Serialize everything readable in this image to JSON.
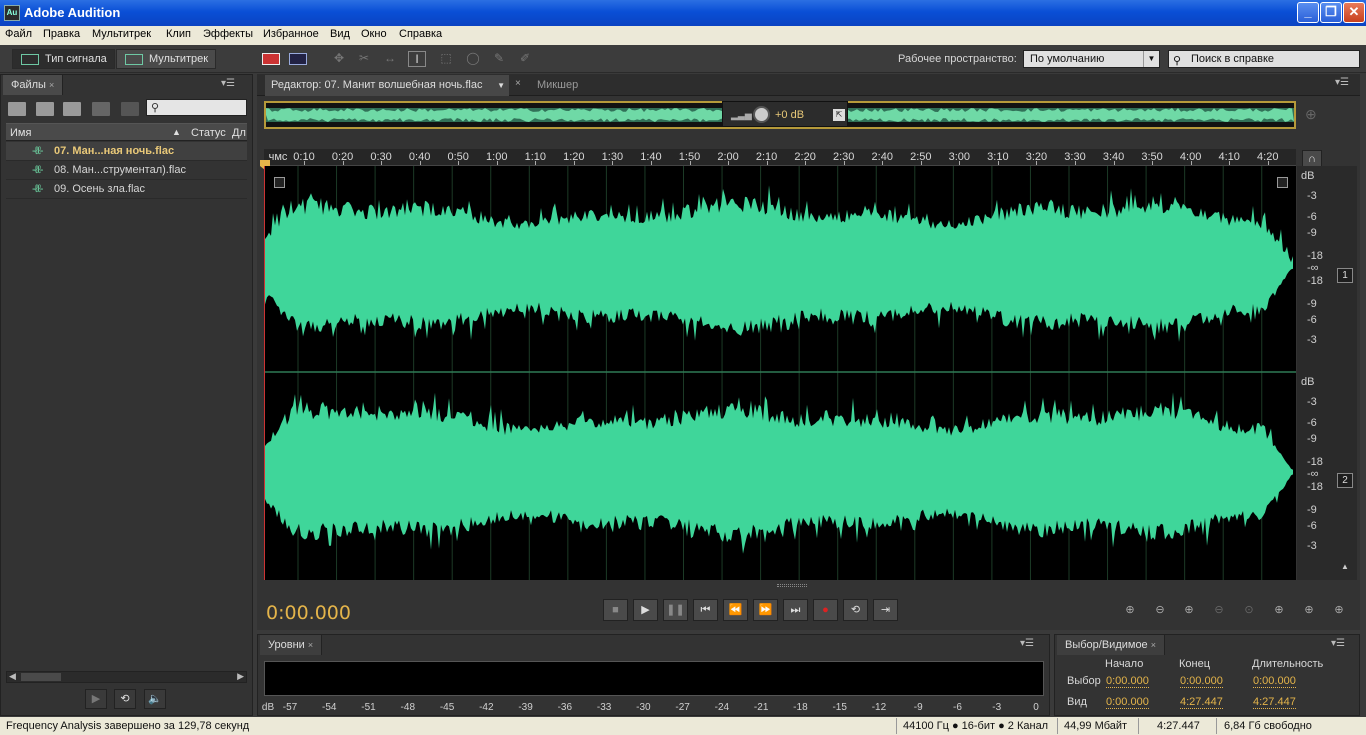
{
  "window": {
    "title": "Adobe Audition",
    "app_icon": "Au"
  },
  "menu": [
    "Файл",
    "Правка",
    "Мультитрек",
    "Клип",
    "Эффекты",
    "Избранное",
    "Вид",
    "Окно",
    "Справка"
  ],
  "toolbar": {
    "waveform_mode": "Тип сигнала",
    "multitrack_mode": "Мультитрек",
    "workspace_label": "Рабочее пространство:",
    "workspace_value": "По умолчанию",
    "help_search_placeholder": "Поиск в справке"
  },
  "files_panel": {
    "tab": "Файлы",
    "columns": [
      "Имя",
      "Статус",
      "Дл"
    ],
    "files": [
      {
        "name": "07. Ман...ная ночь.flac",
        "selected": true
      },
      {
        "name": "08. Ман...струментал).flac",
        "selected": false
      },
      {
        "name": "09. Осень зла.flac",
        "selected": false
      }
    ]
  },
  "editor": {
    "tab": "Редактор: 07. Манит волшебная ночь.flac",
    "mixer_tab": "Микшер",
    "hud_gain": "+0 dB",
    "ruler_unit": "чмс",
    "ruler_ticks": [
      "0:10",
      "0:20",
      "0:30",
      "0:40",
      "0:50",
      "1:00",
      "1:10",
      "1:20",
      "1:30",
      "1:40",
      "1:50",
      "2:00",
      "2:10",
      "2:20",
      "2:30",
      "2:40",
      "2:50",
      "3:00",
      "3:10",
      "3:20",
      "3:30",
      "3:40",
      "3:50",
      "4:00",
      "4:10",
      "4:20"
    ],
    "db_labels": [
      "dB",
      "-3",
      "-6",
      "-9",
      "-18",
      "-∞",
      "-18",
      "-9",
      "-6",
      "-3"
    ],
    "channels": [
      "1",
      "2"
    ],
    "timecode": "0:00.000",
    "wave_color": "#3fd69a"
  },
  "levels_panel": {
    "tab": "Уровни",
    "scale": [
      "dB",
      "-57",
      "-54",
      "-51",
      "-48",
      "-45",
      "-42",
      "-39",
      "-36",
      "-33",
      "-30",
      "-27",
      "-24",
      "-21",
      "-18",
      "-15",
      "-12",
      "-9",
      "-6",
      "-3",
      "0"
    ]
  },
  "selection_panel": {
    "tab": "Выбор/Видимое",
    "headers": {
      "start": "Начало",
      "end": "Конец",
      "duration": "Длительность"
    },
    "selection": {
      "label": "Выбор",
      "start": "0:00.000",
      "end": "0:00.000",
      "duration": "0:00.000"
    },
    "view": {
      "label": "Вид",
      "start": "0:00.000",
      "end": "4:27.447",
      "duration": "4:27.447"
    }
  },
  "status": {
    "message": "Frequency Analysis завершено за 129,78 секунд",
    "format": "44100 Гц ● 16-бит ● 2 Канал",
    "size": "44,99 Мбайт",
    "duration": "4:27.447",
    "free": "6,84 Гб свободно"
  }
}
